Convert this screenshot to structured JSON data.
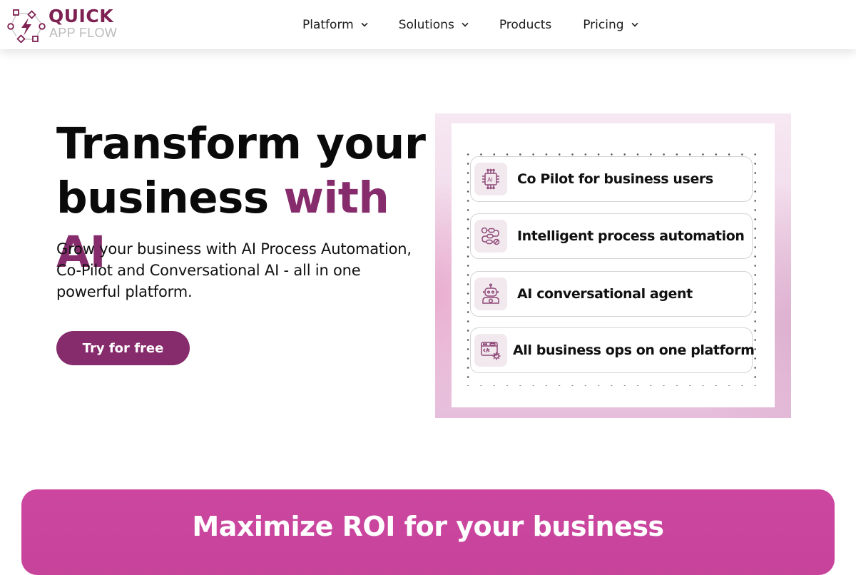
{
  "brand": {
    "name_primary": "QUICK",
    "name_secondary": "APP FLOW",
    "logo_icon": "lightning-cycle-logo",
    "color_primary": "#7e2152",
    "color_secondary": "#bcbcbc"
  },
  "nav": {
    "items": [
      {
        "label": "Platform",
        "has_dropdown": true
      },
      {
        "label": "Solutions",
        "has_dropdown": true
      },
      {
        "label": "Products",
        "has_dropdown": false
      },
      {
        "label": "Pricing",
        "has_dropdown": true
      }
    ]
  },
  "hero": {
    "title_line1": "Transform your",
    "title_line2_plain": "business ",
    "title_line2_accent": "with AI",
    "subtitle": "Grow your business with AI Process Automation, Co-Pilot and Conversational AI - all in one powerful platform.",
    "cta_label": "Try for free",
    "accent_color": "#862c6c"
  },
  "features": {
    "items": [
      {
        "label": "Co Pilot for business users",
        "icon": "ai-chip-icon"
      },
      {
        "label": "Intelligent process automation",
        "icon": "workflow-icon"
      },
      {
        "label": "AI conversational agent",
        "icon": "robot-icon"
      },
      {
        "label": "All business ops on one platform",
        "icon": "code-window-gear-icon"
      }
    ]
  },
  "banner": {
    "title": "Maximize ROI for your business",
    "color": "#cc46a0"
  }
}
